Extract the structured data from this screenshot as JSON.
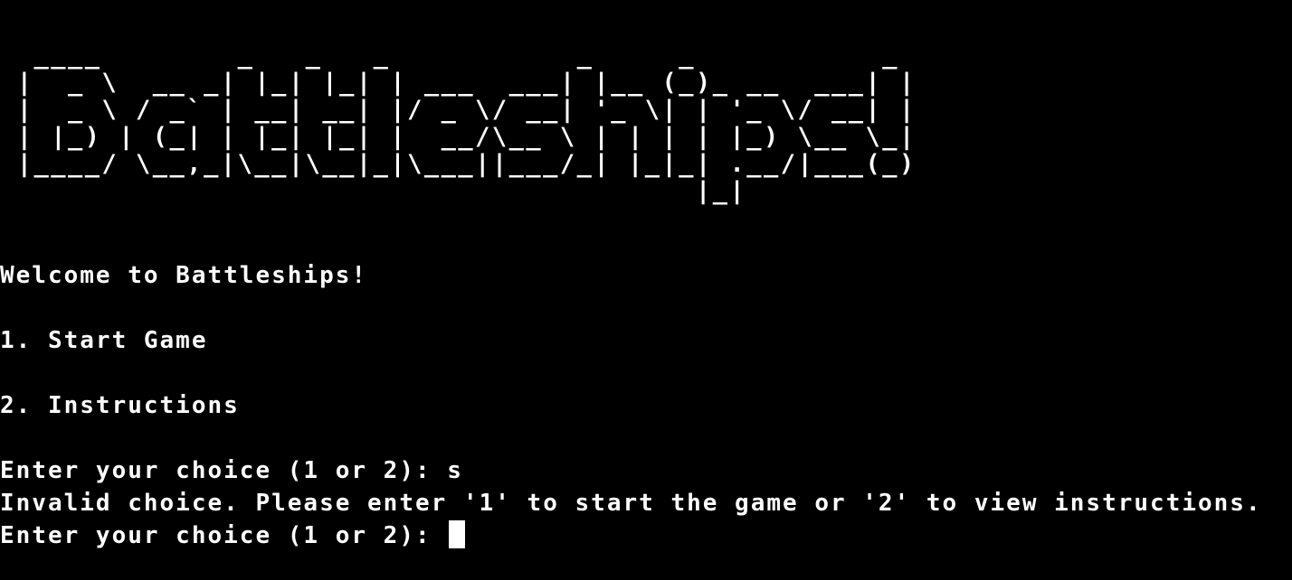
{
  "terminal": {
    "banner": "  ____        _   _   _           _     _           _ \n |  _ \\  __ _| |_| |_| | ___  ___| |__ (_)_ __  ___| |\n |  _ \\ / _` | __| __| |/ _ \\/ __| '_ \\| | '_ \\/ __| |\n | |_) | (_| | |_| |_| |  __/\\__ \\ | | | | |_) \\__ \\_|\n |____/ \\__,_|\\__|\\__|_|\\___||___/_| |_|_| .__/|___(_)\n                                         |_|          ",
    "welcome": "Welcome to Battleships!",
    "option_1": "1. Start Game",
    "option_2": "2. Instructions",
    "prompt_1": "Enter your choice (1 or 2): s",
    "error": "Invalid choice. Please enter '1' to start the game or '2' to view instructions.",
    "prompt_2": "Enter your choice (1 or 2): "
  }
}
